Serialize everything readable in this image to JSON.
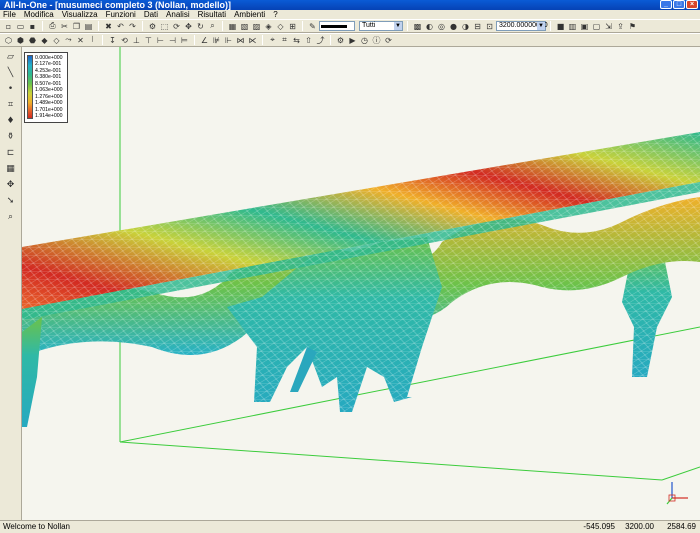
{
  "window": {
    "title": "All-In-One - [musumeci completo 3 (Nollan, modello)]",
    "controls": {
      "minimize": "_",
      "maximize": "□",
      "close": "×"
    }
  },
  "menu": [
    "File",
    "Modifica",
    "Visualizza",
    "Funzioni",
    "Dati",
    "Analisi",
    "Risultati",
    "Ambienti",
    "?"
  ],
  "toolbar": {
    "layer_select": "Tutti",
    "zoom_value": "3200.00000000",
    "line_color": "#000000"
  },
  "legend": {
    "values": [
      "0.000e+000",
      "2.127e-001",
      "4.253e-001",
      "6.380e-001",
      "8.507e-001",
      "1.063e+000",
      "1.276e+000",
      "1.489e+000",
      "1.701e+000",
      "1.914e+000"
    ]
  },
  "colors": {
    "viewport_bg": "#f5f5ee",
    "mesh_low": "#26b1c9",
    "mesh_high": "#d22a22",
    "grid_line": "#3ccc3c"
  },
  "status": {
    "message": "Welcome to Nollan",
    "x": "-545.095",
    "y": "3200.00",
    "z": "2584.69"
  }
}
